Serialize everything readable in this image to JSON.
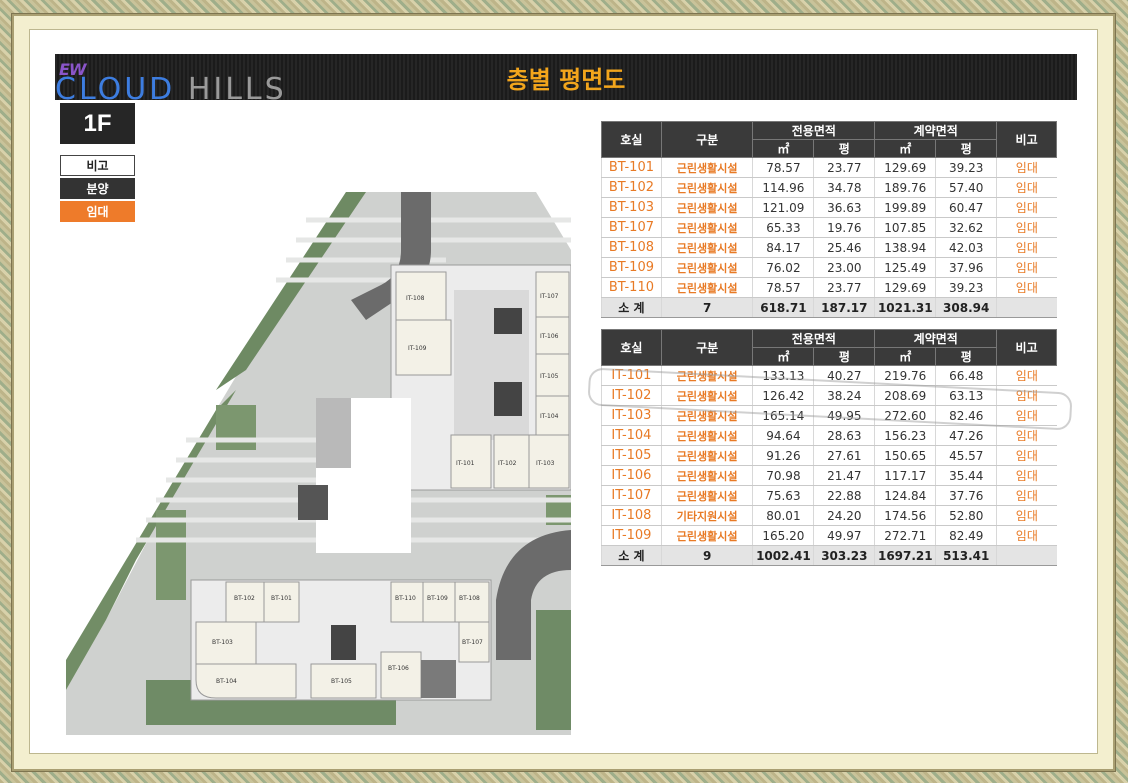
{
  "header": {
    "logo_ew": "EW",
    "logo_cloud": "CLOUD",
    "logo_hills": "HILLS",
    "title": "층별 평면도"
  },
  "floor": "1F",
  "legend": {
    "remark": "비고",
    "sale": "분양",
    "lease": "임대"
  },
  "colors": {
    "header_bg": "#1e1e1e",
    "title": "#f2a51c",
    "accent_orange": "#ee7b2a",
    "table_header": "#3a3a3a",
    "subtotal_bg": "#e4e4e4"
  },
  "table_headers": {
    "room": "호실",
    "category": "구분",
    "exclusive_area": "전용면적",
    "contract_area": "계약면적",
    "remark": "비고",
    "sqm": "㎡",
    "pyeong": "평"
  },
  "table_bt": {
    "rows": [
      {
        "room": "BT-101",
        "category": "근린생활시설",
        "ex_m2": "78.57",
        "ex_py": "23.77",
        "ct_m2": "129.69",
        "ct_py": "39.23",
        "status": "임대"
      },
      {
        "room": "BT-102",
        "category": "근린생활시설",
        "ex_m2": "114.96",
        "ex_py": "34.78",
        "ct_m2": "189.76",
        "ct_py": "57.40",
        "status": "임대"
      },
      {
        "room": "BT-103",
        "category": "근린생활시설",
        "ex_m2": "121.09",
        "ex_py": "36.63",
        "ct_m2": "199.89",
        "ct_py": "60.47",
        "status": "임대"
      },
      {
        "room": "BT-107",
        "category": "근린생활시설",
        "ex_m2": "65.33",
        "ex_py": "19.76",
        "ct_m2": "107.85",
        "ct_py": "32.62",
        "status": "임대"
      },
      {
        "room": "BT-108",
        "category": "근린생활시설",
        "ex_m2": "84.17",
        "ex_py": "25.46",
        "ct_m2": "138.94",
        "ct_py": "42.03",
        "status": "임대"
      },
      {
        "room": "BT-109",
        "category": "근린생활시설",
        "ex_m2": "76.02",
        "ex_py": "23.00",
        "ct_m2": "125.49",
        "ct_py": "37.96",
        "status": "임대"
      },
      {
        "room": "BT-110",
        "category": "근린생활시설",
        "ex_m2": "78.57",
        "ex_py": "23.77",
        "ct_m2": "129.69",
        "ct_py": "39.23",
        "status": "임대"
      }
    ],
    "subtotal": {
      "label": "소 계",
      "count": "7",
      "ex_m2": "618.71",
      "ex_py": "187.17",
      "ct_m2": "1021.31",
      "ct_py": "308.94"
    }
  },
  "table_it": {
    "rows": [
      {
        "room": "IT-101",
        "category": "근린생활시설",
        "ex_m2": "133.13",
        "ex_py": "40.27",
        "ct_m2": "219.76",
        "ct_py": "66.48",
        "status": "임대"
      },
      {
        "room": "IT-102",
        "category": "근린생활시설",
        "ex_m2": "126.42",
        "ex_py": "38.24",
        "ct_m2": "208.69",
        "ct_py": "63.13",
        "status": "임대"
      },
      {
        "room": "IT-103",
        "category": "근린생활시설",
        "ex_m2": "165.14",
        "ex_py": "49.95",
        "ct_m2": "272.60",
        "ct_py": "82.46",
        "status": "임대"
      },
      {
        "room": "IT-104",
        "category": "근린생활시설",
        "ex_m2": "94.64",
        "ex_py": "28.63",
        "ct_m2": "156.23",
        "ct_py": "47.26",
        "status": "임대"
      },
      {
        "room": "IT-105",
        "category": "근린생활시설",
        "ex_m2": "91.26",
        "ex_py": "27.61",
        "ct_m2": "150.65",
        "ct_py": "45.57",
        "status": "임대"
      },
      {
        "room": "IT-106",
        "category": "근린생활시설",
        "ex_m2": "70.98",
        "ex_py": "21.47",
        "ct_m2": "117.17",
        "ct_py": "35.44",
        "status": "임대"
      },
      {
        "room": "IT-107",
        "category": "근린생활시설",
        "ex_m2": "75.63",
        "ex_py": "22.88",
        "ct_m2": "124.84",
        "ct_py": "37.76",
        "status": "임대"
      },
      {
        "room": "IT-108",
        "category": "기타지원시설",
        "ex_m2": "80.01",
        "ex_py": "24.20",
        "ct_m2": "174.56",
        "ct_py": "52.80",
        "status": "임대"
      },
      {
        "room": "IT-109",
        "category": "근린생활시설",
        "ex_m2": "165.20",
        "ex_py": "49.97",
        "ct_m2": "272.71",
        "ct_py": "82.49",
        "status": "임대"
      }
    ],
    "subtotal": {
      "label": "소 계",
      "count": "9",
      "ex_m2": "1002.41",
      "ex_py": "303.23",
      "ct_m2": "1697.21",
      "ct_py": "513.41"
    }
  },
  "plan_labels": {
    "it": [
      "IT-108",
      "IT-107",
      "IT-109",
      "IT-106",
      "IT-105",
      "IT-104",
      "IT-101",
      "IT-102",
      "IT-103"
    ],
    "bt": [
      "BT-102",
      "BT-101",
      "BT-110",
      "BT-109",
      "BT-108",
      "BT-103",
      "BT-107",
      "BT-104",
      "BT-105",
      "BT-106"
    ]
  }
}
